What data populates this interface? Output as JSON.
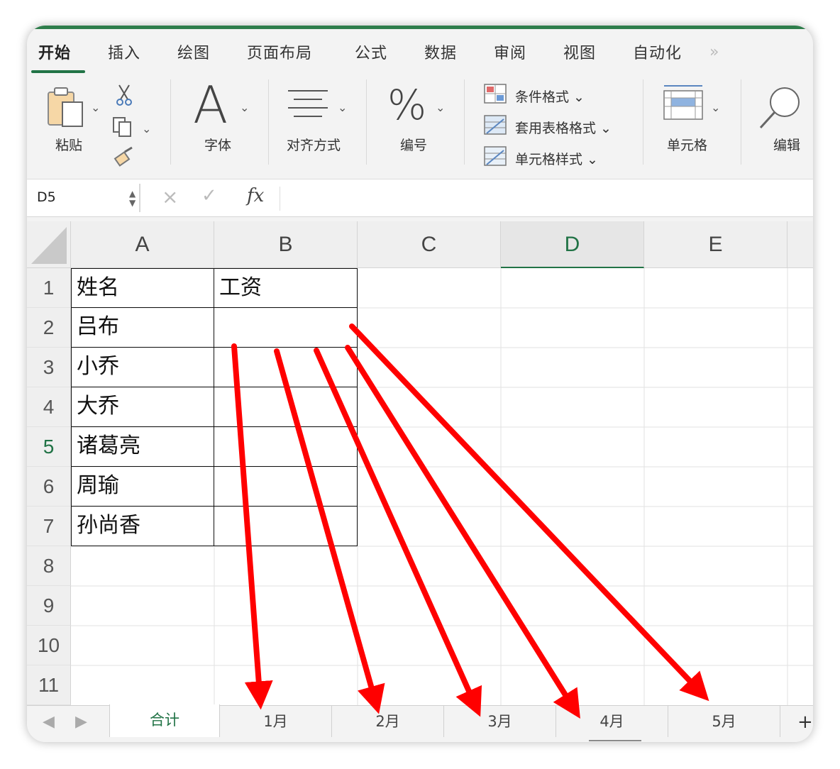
{
  "ribbon_tabs": [
    "开始",
    "插入",
    "绘图",
    "页面布局",
    "公式",
    "数据",
    "审阅",
    "视图",
    "自动化"
  ],
  "ribbon_more": "»",
  "groups": {
    "paste": "粘贴",
    "font": "字体",
    "font_glyph": "A",
    "align": "对齐方式",
    "number": "编号",
    "number_glyph": "%",
    "cond_format": "条件格式",
    "table_format": "套用表格格式",
    "cell_style": "单元格样式",
    "cells": "单元格",
    "edit": "编辑"
  },
  "formula_bar": {
    "name_box": "D5",
    "fx": "fx",
    "content": ""
  },
  "columns": [
    "A",
    "B",
    "C",
    "D",
    "E"
  ],
  "selected_column": "D",
  "rows": [
    "1",
    "2",
    "3",
    "4",
    "5",
    "6",
    "7",
    "8",
    "9",
    "10",
    "11"
  ],
  "selected_row": "5",
  "cells": {
    "A1": "姓名",
    "B1": "工资",
    "A2": "吕布",
    "A3": "小乔",
    "A4": "大乔",
    "A5": "诸葛亮",
    "A6": "周瑜",
    "A7": "孙尚香"
  },
  "sheets": [
    "合计",
    "1月",
    "2月",
    "3月",
    "4月",
    "5月"
  ],
  "active_sheet": "合计",
  "add_sheet": "+",
  "colors": {
    "accent": "#217346",
    "arrow": "#ff0000",
    "top_bar": "#2e7d4b"
  }
}
